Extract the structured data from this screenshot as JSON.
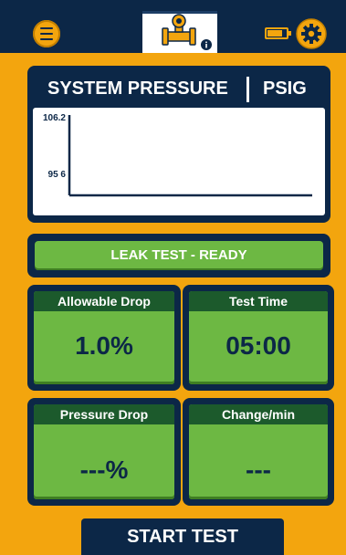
{
  "header": {
    "menu_icon": "hamburger-menu-icon",
    "logo_icon": "pipe-valve-logo-icon",
    "info_icon": "info-icon",
    "battery_icon": "battery-icon",
    "battery_level": 0.8,
    "settings_icon": "gear-icon"
  },
  "pressure": {
    "title": "SYSTEM PRESSURE",
    "unit": "PSIG"
  },
  "chart_data": {
    "type": "line",
    "yticks": [
      "106.2",
      "95 6"
    ],
    "ylim": [
      95.6,
      106.2
    ],
    "series": [],
    "grid": false
  },
  "status": {
    "text": "LEAK TEST - READY"
  },
  "tiles": {
    "allowable_drop": {
      "label": "Allowable Drop",
      "value": "1.0%"
    },
    "test_time": {
      "label": "Test Time",
      "value": "05:00"
    },
    "pressure_drop": {
      "label": "Pressure Drop",
      "value": "---%"
    },
    "change_per_min": {
      "label": "Change/min",
      "value": "---"
    }
  },
  "actions": {
    "start_label": "START TEST"
  },
  "colors": {
    "background": "#f3a50e",
    "navy": "#0c2747",
    "green": "#6db843",
    "dark_green": "#1c5a2c"
  }
}
